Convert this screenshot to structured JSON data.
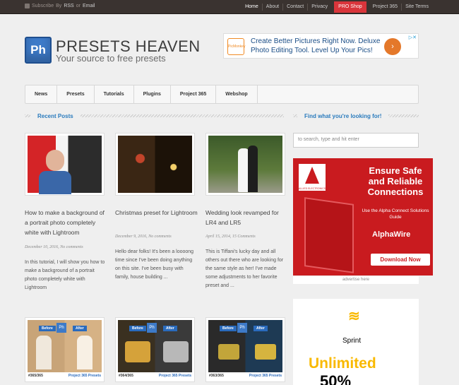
{
  "topbar": {
    "subscribe": "Subscribe",
    "by1": "By",
    "rss": "RSS",
    "or": "or",
    "email": "Email",
    "nav": [
      "Home",
      "About",
      "Contact",
      "Privacy"
    ],
    "pro": "PRO Shop",
    "nav2": [
      "Project 365",
      "Site Terms"
    ]
  },
  "header": {
    "logo": "Ph",
    "title": "PRESETS HEAVEN",
    "tagline": "Your source to free presets"
  },
  "ad": {
    "brand": "PicMonkey",
    "text1": "Create Better Pictures Right Now. Deluxe",
    "text2": "Photo Editing Tool. Level Up Your Pics!",
    "go": "›",
    "adchoice": "▷✕"
  },
  "mainnav": [
    "News",
    "Presets",
    "Tutorials",
    "Plugins",
    "Project 365",
    "Webshop"
  ],
  "recent": {
    "heading": "Recent Posts"
  },
  "find": {
    "heading": "Find what you're looking for!",
    "placeholder": "to search, type and hit enter"
  },
  "posts": [
    {
      "title": "How to make a background of a portrait photo completely white with Lightroom",
      "date": "December 10, 2016, No comments",
      "excerpt": "In this tutorial, I will show you how to make a background of a portrait photo completely white with Lightroom"
    },
    {
      "title": "Christmas preset for Lightroom",
      "date": "December 9, 2016, No comments",
      "excerpt": "Hello dear folks! It's been a loooong time since I've been doing anything on this site. I've been busy with family, house building ..."
    },
    {
      "title": "Wedding look revamped for LR4 and LR5",
      "date": "April 15, 2014, 15 Comments",
      "excerpt": "This is Tiffani's lucky day and all others out there who are looking for the same style as her! I've made some adjustments to her favorite preset and ..."
    }
  ],
  "alpha": {
    "headline": "Ensure Safe and Reliable Connections",
    "sub": "Use the Alpha Connect Solutions Guide",
    "brand": "AlphaWire",
    "download": "Download Now",
    "distributor": "ALLIED ELECTRONICS"
  },
  "advertise": "advertise here",
  "sprint": {
    "brand": "Sprint",
    "unlimited": "Unlimited",
    "pct": "50%"
  },
  "bottom": [
    {
      "num": "#365/365",
      "tag": "Project 365 Presets",
      "before": "Before",
      "after": "After",
      "ph": "Ph"
    },
    {
      "num": "#364/365",
      "tag": "Project 365 Presets",
      "before": "Before",
      "after": "After",
      "ph": "Ph"
    },
    {
      "num": "#363/365",
      "tag": "Project 365 Presets",
      "before": "Before",
      "after": "After",
      "ph": "Ph"
    }
  ]
}
